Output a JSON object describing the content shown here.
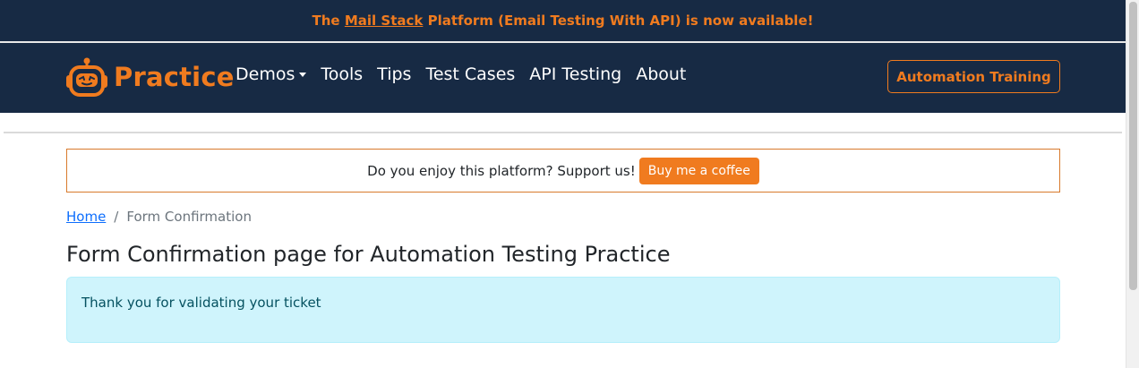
{
  "announcement": {
    "prefix": "The",
    "link": "Mail Stack",
    "suffix": "Platform (Email Testing With API) is now available!"
  },
  "brand": {
    "name": "Practice",
    "icon": "robot-icon"
  },
  "nav": {
    "demos": "Demos",
    "tools": "Tools",
    "tips": "Tips",
    "test_cases": "Test Cases",
    "api_testing": "API Testing",
    "about": "About",
    "training_button": "Automation Training"
  },
  "support": {
    "text": "Do you enjoy this platform? Support us!",
    "button": "Buy me a coffee"
  },
  "breadcrumb": {
    "home": "Home",
    "separator": "/",
    "current": "Form Confirmation"
  },
  "page": {
    "title": "Form Confirmation page for Automation Testing Practice",
    "alert": "Thank you for validating your ticket"
  },
  "colors": {
    "navy": "#172a44",
    "orange": "#f07b1f",
    "alert_bg": "#cff4fc",
    "alert_text": "#055160",
    "link": "#0d6efd"
  }
}
